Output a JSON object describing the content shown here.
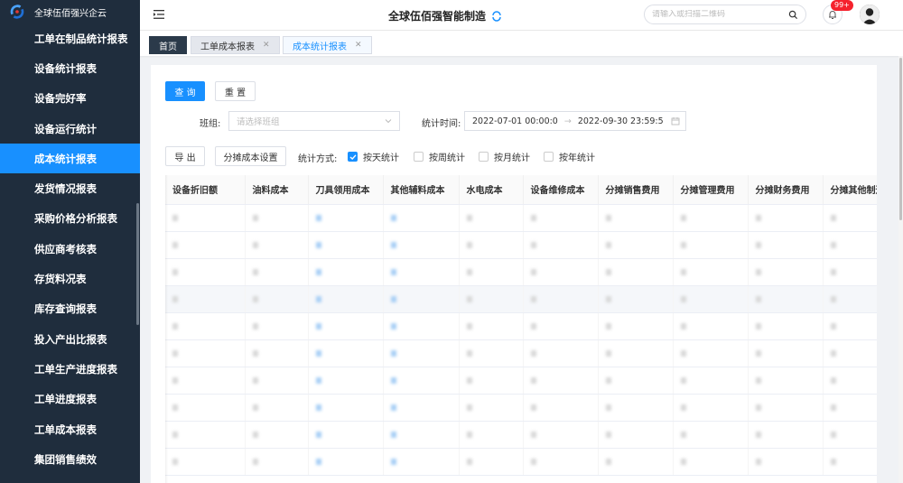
{
  "sidebar": {
    "brand": "全球伍佰强兴企云",
    "items": [
      {
        "label": "工单在制品统计报表",
        "active": false
      },
      {
        "label": "设备统计报表",
        "active": false
      },
      {
        "label": "设备完好率",
        "active": false
      },
      {
        "label": "设备运行统计",
        "active": false
      },
      {
        "label": "成本统计报表",
        "active": true
      },
      {
        "label": "发货情况报表",
        "active": false
      },
      {
        "label": "采购价格分析报表",
        "active": false
      },
      {
        "label": "供应商考核表",
        "active": false
      },
      {
        "label": "存货料况表",
        "active": false
      },
      {
        "label": "库存查询报表",
        "active": false
      },
      {
        "label": "投入产出比报表",
        "active": false
      },
      {
        "label": "工单生产进度报表",
        "active": false
      },
      {
        "label": "工单进度报表",
        "active": false
      },
      {
        "label": "工单成本报表",
        "active": false
      },
      {
        "label": "集团销售绩效",
        "active": false
      }
    ]
  },
  "topbar": {
    "title": "全球伍佰强智能制造",
    "search_placeholder": "请输入或扫描二维码",
    "badge": "99+"
  },
  "tabs": [
    {
      "label": "首页",
      "closable": false
    },
    {
      "label": "工单成本报表",
      "closable": true
    },
    {
      "label": "成本统计报表",
      "closable": true,
      "active": true
    }
  ],
  "filters": {
    "query_button": "查 询",
    "reset_button": "重 置",
    "team_label": "班组:",
    "team_placeholder": "请选择班组",
    "time_label": "统计时间:",
    "time_start": "2022-07-01 00:00:0",
    "time_end": "2022-09-30 23:59:5",
    "export_button": "导 出",
    "allocate_button": "分摊成本设置",
    "method_label": "统计方式:",
    "methods": [
      {
        "label": "按天统计",
        "checked": true
      },
      {
        "label": "按周统计",
        "checked": false
      },
      {
        "label": "按月统计",
        "checked": false
      },
      {
        "label": "按年统计",
        "checked": false
      }
    ]
  },
  "table": {
    "columns": [
      "设备折旧额",
      "油料成本",
      "刀具领用成本",
      "其他辅料成本",
      "水电成本",
      "设备维修成本",
      "分摊销售费用",
      "分摊管理费用",
      "分摊财务费用",
      "分摊其他制造"
    ],
    "row_count": 10
  },
  "colors": {
    "sidebar_bg": "#1f2d3d",
    "accent": "#1890ff",
    "badge": "#f5222d"
  }
}
